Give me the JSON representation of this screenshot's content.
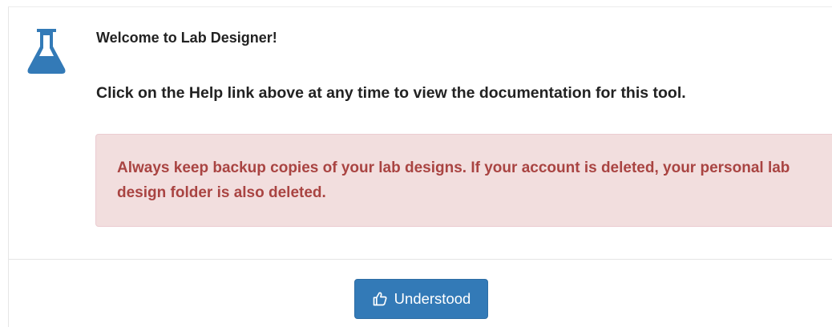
{
  "dialog": {
    "icon": "flask-icon",
    "welcome_text": "Welcome to Lab Designer!",
    "help_text": "Click on the Help link above at any time to view the documentation for this tool.",
    "alert_text": "Always keep backup copies of your lab designs. If your account is deleted, your personal lab design folder is also deleted.",
    "button_icon": "thumbs-up-icon",
    "button_label": "Understood"
  },
  "colors": {
    "icon_blue": "#337ab7",
    "alert_background": "#f2dede",
    "alert_text": "#a94442",
    "button_background": "#337ab7"
  }
}
